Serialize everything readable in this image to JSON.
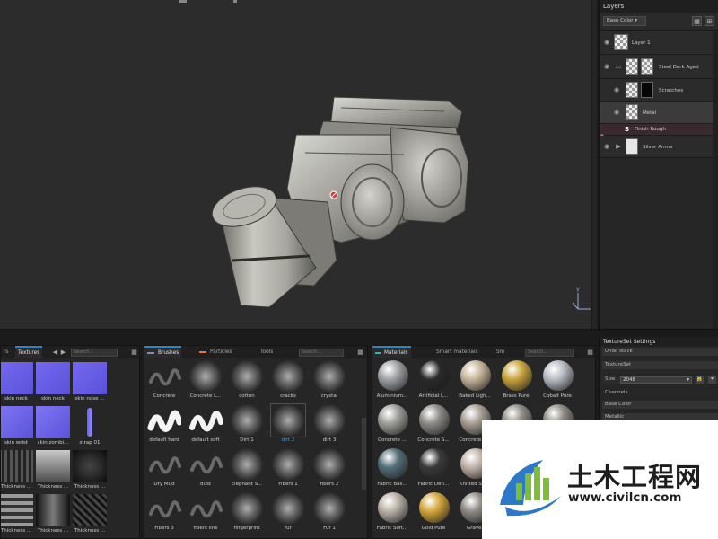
{
  "layers_panel": {
    "title": "Layers",
    "channel_select": "Base Color",
    "layers": [
      {
        "name": "Layer 1"
      },
      {
        "name": "Steel Dark Aged"
      },
      {
        "name": "Scratches"
      },
      {
        "name": "Metal"
      },
      {
        "name": "Silver Armor"
      }
    ],
    "effect": {
      "name": "Finish Rough"
    }
  },
  "texture_tabs": {
    "tab_partial": "rs",
    "active_tab": "Textures",
    "search_placeholder": "Search..."
  },
  "textures": [
    {
      "label": "skin neck"
    },
    {
      "label": "skin neck"
    },
    {
      "label": "skin nose ..."
    },
    {
      "label": "skin wrist"
    },
    {
      "label": "skin zombi..."
    },
    {
      "label": "strap 01"
    },
    {
      "label": "Thickness ..."
    },
    {
      "label": "Thickness ..."
    },
    {
      "label": "Thickness ..."
    },
    {
      "label": "Thickness ..."
    },
    {
      "label": "Thickness ..."
    },
    {
      "label": "Thickness ..."
    }
  ],
  "brush_tabs": {
    "brushes": "Brushes",
    "particles": "Particles",
    "tools": "Tools",
    "search_placeholder": "Search..."
  },
  "brushes": [
    {
      "label": "Concrete"
    },
    {
      "label": "Concrete L..."
    },
    {
      "label": "cotton"
    },
    {
      "label": "cracks"
    },
    {
      "label": "crystal"
    },
    {
      "label": "default hard"
    },
    {
      "label": "default soft"
    },
    {
      "label": "Dirt 1"
    },
    {
      "label": "dirt 2"
    },
    {
      "label": "dirt 3"
    },
    {
      "label": "Dry Mud"
    },
    {
      "label": "dust"
    },
    {
      "label": "Elephant S..."
    },
    {
      "label": "Fibers 1"
    },
    {
      "label": "fibers 2"
    },
    {
      "label": "Fibers 3"
    },
    {
      "label": "fibers line"
    },
    {
      "label": "fingerprint"
    },
    {
      "label": "fur"
    },
    {
      "label": "Fur 1"
    }
  ],
  "material_tabs": {
    "materials": "Materials",
    "smart_materials": "Smart materials",
    "smart_partial": "Sm",
    "search_placeholder": "Search..."
  },
  "materials": [
    {
      "label": "Aluminium..."
    },
    {
      "label": "Artificial L..."
    },
    {
      "label": "Baked Ligh..."
    },
    {
      "label": "Brass Pure"
    },
    {
      "label": "Cobalt Pure"
    },
    {
      "label": "Concrete ..."
    },
    {
      "label": "Concrete S..."
    },
    {
      "label": "Concrete S..."
    },
    {
      "label": ""
    },
    {
      "label": ""
    },
    {
      "label": "Fabric Bas..."
    },
    {
      "label": "Fabric Den..."
    },
    {
      "label": "Knitted Sw..."
    },
    {
      "label": ""
    },
    {
      "label": ""
    },
    {
      "label": "Fabric Soft..."
    },
    {
      "label": "Gold Pure"
    },
    {
      "label": "Gravel"
    },
    {
      "label": ""
    },
    {
      "label": ""
    }
  ],
  "textureset_settings": {
    "title": "TextureSet Settings",
    "undo_stack": "Undo stack",
    "textureset": "TextureSet",
    "size_label": "Size",
    "size_value": "2048",
    "channels_label": "Channels",
    "channel_1": "Base Color",
    "channel_2": "Metallic"
  },
  "watermark": {
    "chinese": "土木工程网",
    "url": "www.civilcn.com"
  }
}
